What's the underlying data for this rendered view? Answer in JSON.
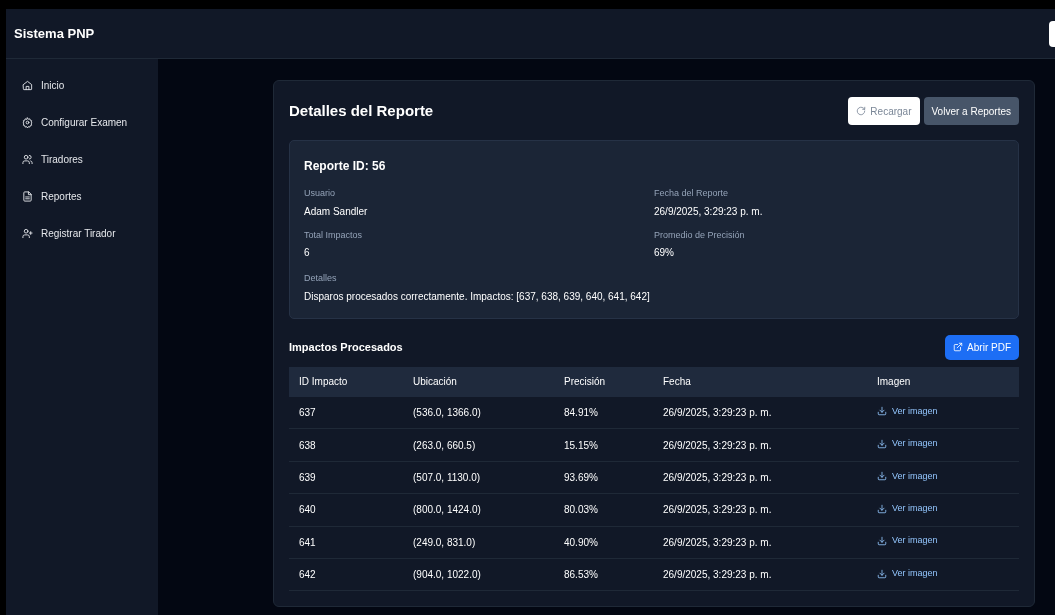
{
  "app_title": "Sistema PNP",
  "sidebar": {
    "items": [
      {
        "label": "Inicio"
      },
      {
        "label": "Configurar Examen"
      },
      {
        "label": "Tiradores"
      },
      {
        "label": "Reportes"
      },
      {
        "label": "Registrar Tirador"
      }
    ]
  },
  "title": "Detalles del Reporte",
  "buttons": [
    {
      "label": "Recargar",
      "kind": "reload",
      "disabled": true
    },
    {
      "label": "Volver a Reportes",
      "kind": "back",
      "disabled": false
    }
  ],
  "report": {
    "heading": "Reporte ID: 56",
    "fields": [
      {
        "label": "Usuario",
        "value": "Adam Sandler"
      },
      {
        "label": "Fecha del Reporte",
        "value": "26/9/2025, 3:29:23 p. m."
      },
      {
        "label": "Total Impactos",
        "value": "6"
      },
      {
        "label": "Promedio de Precisión",
        "value": "69%"
      }
    ],
    "details": {
      "label": "Detalles",
      "value": "Disparos procesados correctamente. Impactos: [637, 638, 639, 640, 641, 642]"
    }
  },
  "impacts": {
    "title": "Impactos Procesados",
    "pdf_button": "Abrir PDF",
    "columns": [
      "ID Impacto",
      "Ubicación",
      "Precisión",
      "Fecha",
      "Imagen"
    ],
    "rows": [
      {
        "id": "637",
        "location": "(536.0, 1366.0)",
        "precision": "84.91%",
        "date": "26/9/2025, 3:29:23 p. m.",
        "link": "Ver imagen"
      },
      {
        "id": "638",
        "location": "(263.0, 660.5)",
        "precision": "15.15%",
        "date": "26/9/2025, 3:29:23 p. m.",
        "link": "Ver imagen"
      },
      {
        "id": "639",
        "location": "(507.0, 1130.0)",
        "precision": "93.69%",
        "date": "26/9/2025, 3:29:23 p. m.",
        "link": "Ver imagen"
      },
      {
        "id": "640",
        "location": "(800.0, 1424.0)",
        "precision": "80.03%",
        "date": "26/9/2025, 3:29:23 p. m.",
        "link": "Ver imagen"
      },
      {
        "id": "641",
        "location": "(249.0, 831.0)",
        "precision": "40.90%",
        "date": "26/9/2025, 3:29:23 p. m.",
        "link": "Ver imagen"
      },
      {
        "id": "642",
        "location": "(904.0, 1022.0)",
        "precision": "86.53%",
        "date": "26/9/2025, 3:29:23 p. m.",
        "link": "Ver imagen"
      }
    ]
  }
}
